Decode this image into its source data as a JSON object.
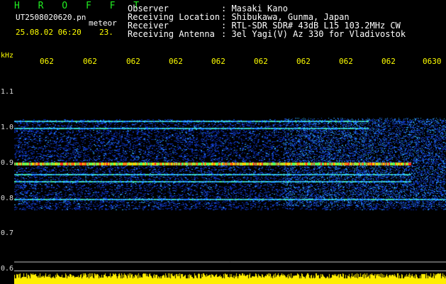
{
  "header": {
    "brand": "H R O F F T",
    "filename": "UT2508020620.pn",
    "tag": "meteor",
    "datetime": "25.08.02 06:20",
    "number": "23."
  },
  "info": [
    {
      "label": "Observer",
      "value": ": Masaki Kano"
    },
    {
      "label": "Receiving Location",
      "value": ": Shibukawa, Gunma, Japan"
    },
    {
      "label": "Receiver",
      "value": ": RTL-SDR SDR# 43dB L15 103.2MHz CW"
    },
    {
      "label": "Receiving Antenna",
      "value": ": 3el Yagi(V) Az 330 for Vladivostok"
    }
  ],
  "chart_data": {
    "type": "heatmap",
    "ylabel": "kHz",
    "yticks": [
      "1.1",
      "1.0",
      "0.9",
      "0.8",
      "0.7",
      "0.6"
    ],
    "ylim": [
      0.6,
      1.12
    ],
    "xticks": [
      "062",
      "062",
      "062",
      "062",
      "062",
      "062",
      "062",
      "062",
      "062",
      "0630"
    ],
    "signal_bands_khz": [
      1.02,
      1.0,
      0.9,
      0.87,
      0.85,
      0.8
    ],
    "strong_band_khz": 0.9
  },
  "colors": {
    "background": "#000000",
    "brand": "#22ee22",
    "accent": "#ffff00",
    "noise": "#0a2aa8"
  }
}
